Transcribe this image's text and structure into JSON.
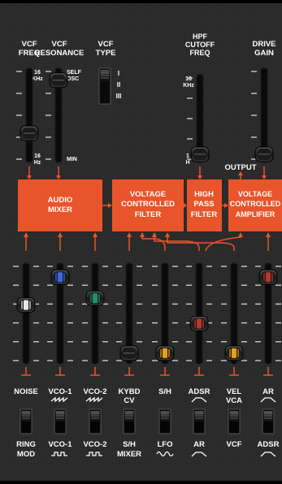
{
  "colors": {
    "panel": "#2b2b2b",
    "accent": "#e8552a",
    "text": "#ffffff",
    "slot": "#0b0b0b",
    "tick": "#d8d8d8"
  },
  "top_labels": {
    "vcf_freq": [
      "VCF",
      "FREQ"
    ],
    "vcf_resonance": [
      "VCF",
      "RESONANCE"
    ],
    "vcf_type": [
      "VCF",
      "TYPE"
    ],
    "hpf_cutoff": [
      "HPF",
      "CUTOFF",
      "FREQ"
    ],
    "drive_gain": [
      "DRIVE",
      "GAIN"
    ]
  },
  "scale_labels": {
    "vcf_freq_top": [
      "16",
      "KHz"
    ],
    "vcf_freq_bottom": [
      "16",
      "Hz"
    ],
    "res_top": [
      "SELF",
      "OSC"
    ],
    "res_bottom": "MIN",
    "hpf_top": [
      "16",
      "KHz"
    ],
    "hpf_bottom": [
      "1",
      "H"
    ]
  },
  "vcf_type_options": [
    "I",
    "II",
    "III"
  ],
  "blocks": {
    "audio_mixer": [
      "AUDIO",
      "MIXER"
    ],
    "vcf": [
      "VOLTAGE",
      "CONTROLLED",
      "FILTER"
    ],
    "hpf": [
      "HIGH",
      "PASS",
      "FILTER"
    ],
    "vca": [
      "VOLTAGE",
      "CONTROLLED",
      "AMPLIFIER"
    ]
  },
  "output_label": "OUTPUT",
  "faders": [
    {
      "top": "NOISE",
      "bottom": "",
      "wave": "",
      "knob": "white",
      "level": 0.6
    },
    {
      "top": "VCO-1",
      "bottom": "",
      "wave": "saw",
      "knob": "blue",
      "level": 0.93
    },
    {
      "top": "VCO-2",
      "bottom": "",
      "wave": "saw",
      "knob": "green",
      "level": 0.68
    },
    {
      "top": "KYBD",
      "bottom": "CV",
      "wave": "",
      "knob": "black",
      "level": 0.03
    },
    {
      "top": "S/H",
      "bottom": "",
      "wave": "",
      "knob": "orange",
      "level": 0.03
    },
    {
      "top": "ADSR",
      "bottom": "",
      "wave": "env",
      "knob": "red",
      "level": 0.38
    },
    {
      "top": "VEL",
      "bottom": "VCA",
      "wave": "",
      "knob": "orange",
      "level": 0.03
    },
    {
      "top": "AR",
      "bottom": "",
      "wave": "env",
      "knob": "red",
      "level": 0.93
    }
  ],
  "switches": [
    {
      "top": "RING",
      "bottom": "MOD",
      "wave": ""
    },
    {
      "top": "VCO-1",
      "bottom": "",
      "wave": "square"
    },
    {
      "top": "VCO-2",
      "bottom": "",
      "wave": "square"
    },
    {
      "top": "S/H",
      "bottom": "MIXER",
      "wave": ""
    },
    {
      "top": "LFO",
      "bottom": "",
      "wave": "sine"
    },
    {
      "top": "AR",
      "bottom": "",
      "wave": "env"
    },
    {
      "top": "VCF",
      "bottom": "",
      "wave": ""
    },
    {
      "top": "ADSR",
      "bottom": "",
      "wave": "env"
    }
  ],
  "top_faders": {
    "vcf_freq": 0.27,
    "vcf_resonance": 0.95,
    "hpf_cutoff": 0.0,
    "drive_gain": 0.0
  }
}
